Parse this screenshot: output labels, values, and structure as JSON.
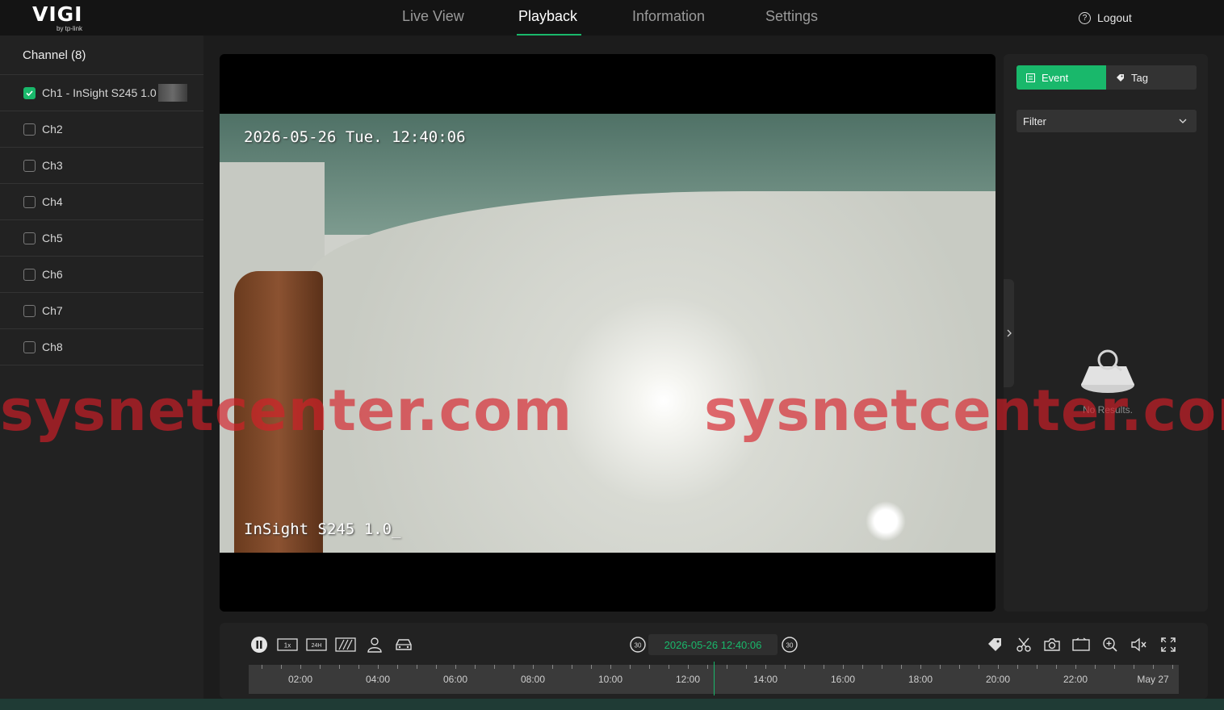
{
  "header": {
    "logo": "VIGI",
    "logo_sub": "by tp-link",
    "tabs": [
      "Live View",
      "Playback",
      "Information",
      "Settings"
    ],
    "active_tab": "Playback",
    "logout_label": "Logout"
  },
  "sidebar": {
    "title": "Channel (8)",
    "channels": [
      {
        "label": "Ch1 - InSight S245 1.0",
        "checked": true
      },
      {
        "label": "Ch2",
        "checked": false
      },
      {
        "label": "Ch3",
        "checked": false
      },
      {
        "label": "Ch4",
        "checked": false
      },
      {
        "label": "Ch5",
        "checked": false
      },
      {
        "label": "Ch6",
        "checked": false
      },
      {
        "label": "Ch7",
        "checked": false
      },
      {
        "label": "Ch8",
        "checked": false
      }
    ]
  },
  "video": {
    "osd_datetime": "2026-05-26 Tue. 12:40:06",
    "osd_camera": "InSight S245 1.0_"
  },
  "watermark": "sysnetcenter.com",
  "right_panel": {
    "event_tab": "Event",
    "tag_tab": "Tag",
    "filter_label": "Filter",
    "no_results": "No Results."
  },
  "controls": {
    "speed_label": "1x",
    "range_label": "24H",
    "skip_back_label": "30",
    "skip_forward_label": "30",
    "current_time": "2026-05-26 12:40:06",
    "accent_color": "#19b86b",
    "timeline_labels": [
      "02:00",
      "04:00",
      "06:00",
      "08:00",
      "10:00",
      "12:00",
      "14:00",
      "16:00",
      "18:00",
      "20:00",
      "22:00",
      "May 27"
    ]
  }
}
